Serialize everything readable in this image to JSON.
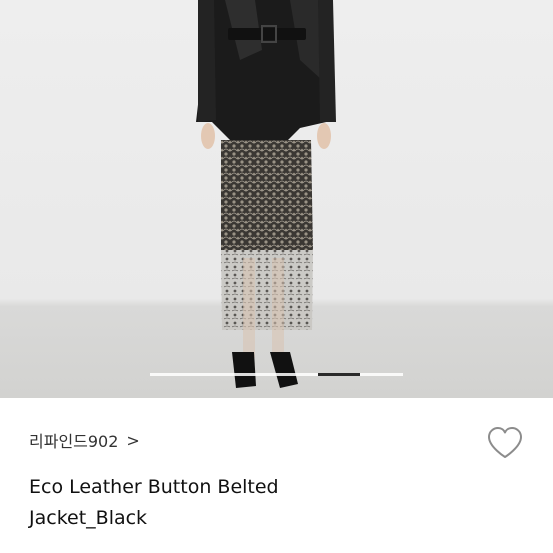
{
  "product": {
    "image_alt": "model wearing black eco leather belted jacket with lace skirt",
    "carousel": {
      "total": 4,
      "active_index": 2
    },
    "shop_name": "리파인드902",
    "shop_chevron": ">",
    "title_line1": "Eco Leather Button Belted",
    "title_line2": "Jacket_Black",
    "wishlist_icon": "heart-outline-icon"
  },
  "colors": {
    "text": "#111111",
    "indicator_active": "#2a2a2a",
    "heart_stroke": "#8c8c8c"
  }
}
